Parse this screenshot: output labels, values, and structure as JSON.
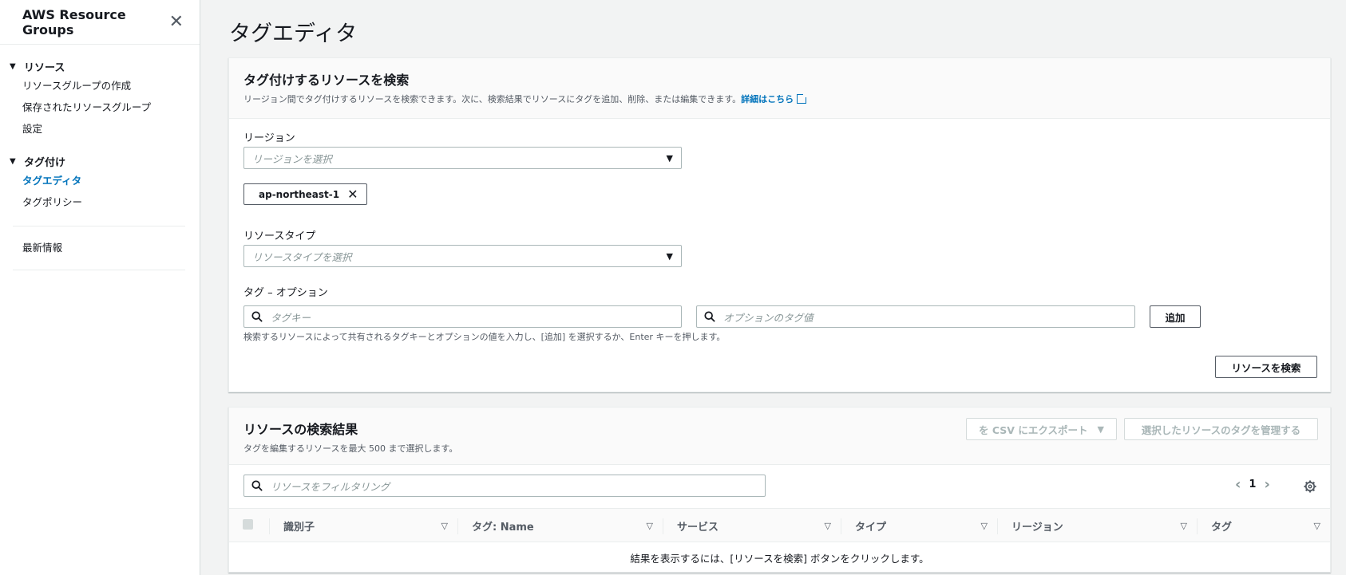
{
  "sidebar": {
    "title": "AWS Resource Groups",
    "sections": [
      {
        "label": "リソース",
        "items": [
          "リソースグループの作成",
          "保存されたリソースグループ",
          "設定"
        ]
      },
      {
        "label": "タグ付け",
        "items": [
          "タグエディタ",
          "タグポリシー"
        ]
      }
    ],
    "whats_new": "最新情報"
  },
  "page_title": "タグエディタ",
  "search_panel": {
    "title": "タグ付けするリソースを検索",
    "desc": "リージョン間でタグ付けするリソースを検索できます。次に、検索結果でリソースにタグを追加、削除、または編集できます。",
    "learn_more": "詳細はこちら",
    "region_label": "リージョン",
    "region_placeholder": "リージョンを選択",
    "region_token": "ap-northeast-1",
    "resource_type_label": "リソースタイプ",
    "resource_type_placeholder": "リソースタイプを選択",
    "tags_label": "タグ – オプション",
    "tag_key_placeholder": "タグキー",
    "tag_value_placeholder": "オプションのタグ値",
    "add_button": "追加",
    "tags_hint": "検索するリソースによって共有されるタグキーとオプションの値を入力し、[追加] を選択するか、Enter キーを押します。",
    "search_button": "リソースを検索"
  },
  "results_panel": {
    "title": "リソースの検索結果",
    "desc": "タグを編集するリソースを最大 500 まで選択します。",
    "export_button": "を CSV にエクスポート",
    "manage_tags_button": "選択したリソースのタグを管理する",
    "filter_placeholder": "リソースをフィルタリング",
    "page": "1",
    "columns": [
      "識別子",
      "タグ: Name",
      "サービス",
      "タイプ",
      "リージョン",
      "タグ"
    ],
    "empty_message": "結果を表示するには、[リソースを検索] ボタンをクリックします。"
  },
  "colors": {
    "link": "#0073bb",
    "border": "#aab7b8",
    "bg": "#f2f3f3"
  }
}
